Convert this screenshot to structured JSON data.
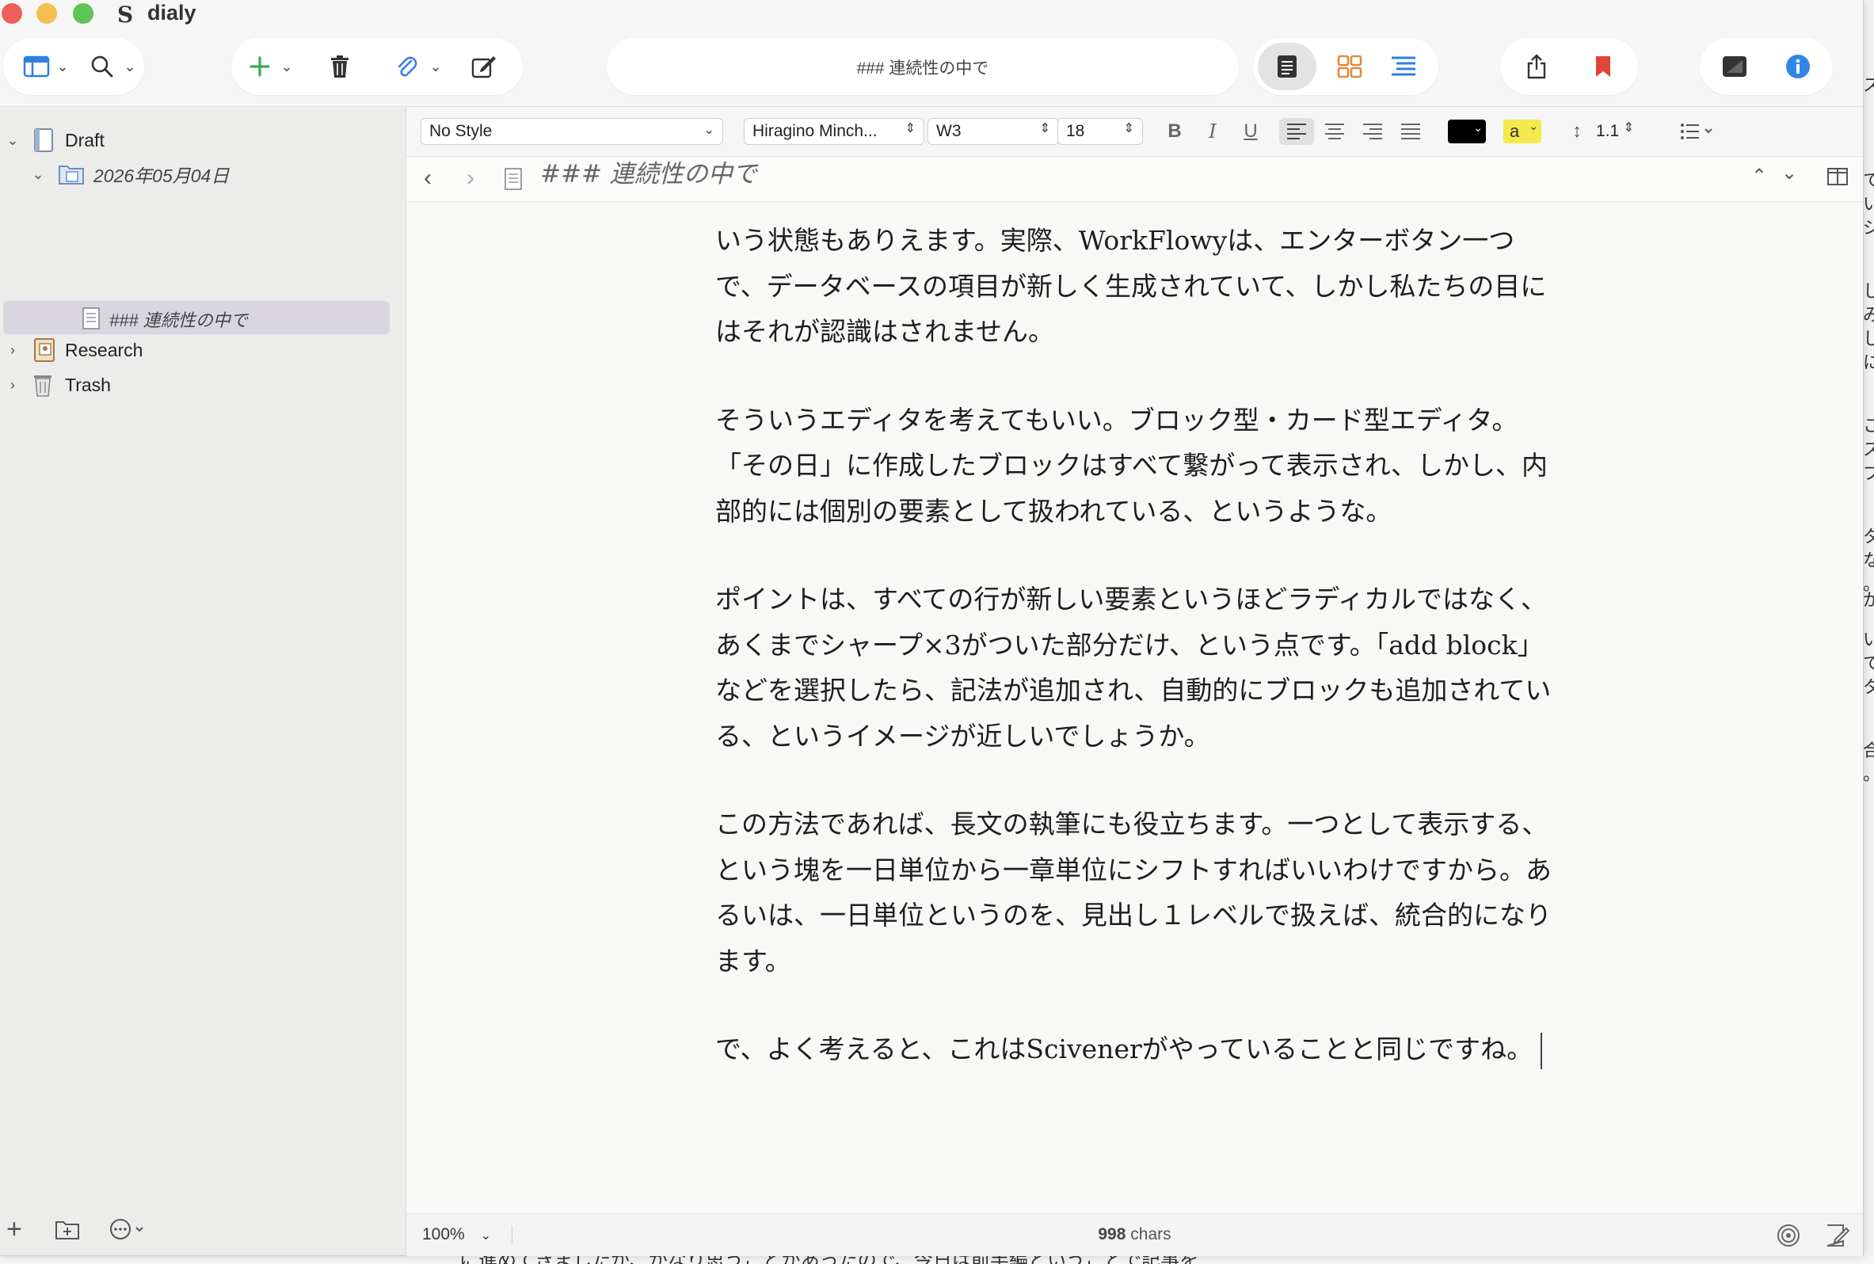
{
  "app": {
    "title": "dialy",
    "icon_letter": "S"
  },
  "toolbar": {
    "address": "### 連続性の中で",
    "colors": {
      "add": "#3aa852",
      "attach": "#3b7fe0",
      "bookmark": "#e0453a",
      "info": "#2f86e8",
      "corkboard": "#e08a3a",
      "outline": "#2f7fe0"
    }
  },
  "sidebar": {
    "items": [
      {
        "label": "Draft",
        "expanded": true,
        "icon": "draft-binder-icon"
      },
      {
        "label": "2026年05月04日",
        "expanded": true,
        "icon": "folder-icon"
      },
      {
        "label": "### 連続性の中で",
        "selected": true,
        "icon": "document-icon"
      },
      {
        "label": "Research",
        "expanded": false,
        "icon": "research-folder-icon"
      },
      {
        "label": "Trash",
        "expanded": false,
        "icon": "trash-icon"
      }
    ]
  },
  "format": {
    "style": "No Style",
    "font": "Hiragino Minch...",
    "weight": "W3",
    "size": "18",
    "bold": "B",
    "italic": "I",
    "underline": "U",
    "highlight_letter": "a",
    "line_spacing": "1.1",
    "text_color": "#000000",
    "highlight_color": "#f5e94d"
  },
  "header": {
    "doc_title": "### 連続性の中で"
  },
  "editor": {
    "paragraphs": [
      "いう状態もありえます。実際、WorkFlowyは、エンターボタン一つで、データベースの項目が新しく生成されていて、しかし私たちの目にはそれが認識はされません。",
      "そういうエディタを考えてもいい。ブロック型・カード型エディタ。「その日」に作成したブロックはすべて繋がって表示され、しかし、内部的には個別の要素として扱われている、というような。",
      "ポイントは、すべての行が新しい要素というほどラディカルではなく、あくまでシャープ×3がついた部分だけ、という点です。「add block」などを選択したら、記法が追加され、自動的にブロックも追加されている、というイメージが近しいでしょうか。",
      "この方法であれば、長文の執筆にも役立ちます。一つとして表示する、という塊を一日単位から一章単位にシフトすればいいわけですから。あるいは、一日単位というのを、見出し１レベルで扱えば、統合的になります。",
      "で、よく考えると、これはScivenerがやっていることと同じですね。"
    ]
  },
  "status": {
    "zoom": "100%",
    "char_count": "998",
    "chars_label": "chars"
  },
  "background": {
    "right_chars": [
      "ス",
      "て",
      "い",
      "ジ",
      "し",
      "み",
      "し",
      "に",
      "こ",
      "ス",
      "プ",
      "タ",
      "な",
      "。",
      "が",
      "い",
      "て",
      "タ",
      "合",
      "。"
    ],
    "bottom_text": "に進めてきましたが、かなり思うことがあったので、今日は前半編ということで記事を"
  }
}
